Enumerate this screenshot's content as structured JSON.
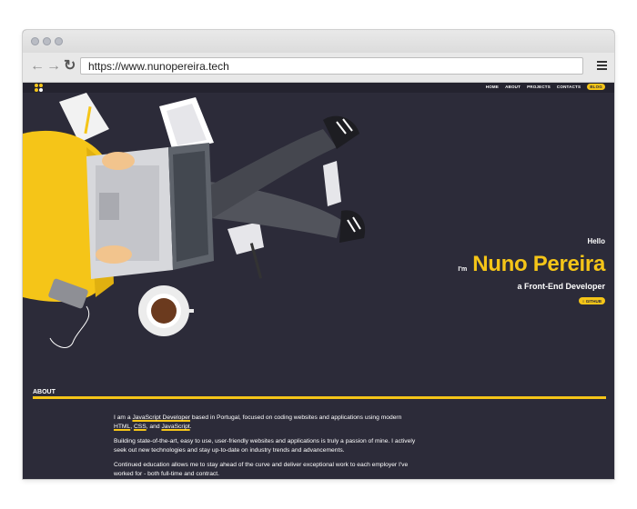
{
  "browser": {
    "url": "https://www.nunopereira.tech",
    "back_icon": "arrow-left-icon",
    "forward_icon": "arrow-right-icon",
    "reload_icon": "reload-icon",
    "menu_icon": "hamburger-menu-icon"
  },
  "site": {
    "nav": {
      "home": "HOME",
      "about": "ABOUT",
      "projects": "PROJECTS",
      "contacts": "CONTACTS",
      "blog": "BLOG"
    },
    "hero": {
      "hello": "Hello",
      "im": "I'm",
      "name": "Nuno Pereira",
      "role": "a Front-End Developer",
      "github": "GITHUB"
    },
    "about": {
      "title": "ABOUT",
      "p1_a": "I am a ",
      "p1_link1": "JavaScript Developer",
      "p1_b": " based in Portugal, focused on coding websites and applications using modern ",
      "p1_link2": "HTML",
      "p1_c": ", ",
      "p1_link3": "CSS",
      "p1_d": ", and ",
      "p1_link4": "JavaScript",
      "p1_e": ".",
      "p2": "Building state-of-the-art, easy to use, user-friendly websites and applications is truly a passion of mine. I actively seek out new technologies and stay up-to-date on industry trends and advancements.",
      "p3": "Continued education allows me to stay ahead of the curve and deliver exceptional work to each employer I've worked for - both full-time and contract."
    },
    "colors": {
      "background": "#2c2b39",
      "accent": "#f5c518",
      "text": "#ffffff"
    }
  }
}
